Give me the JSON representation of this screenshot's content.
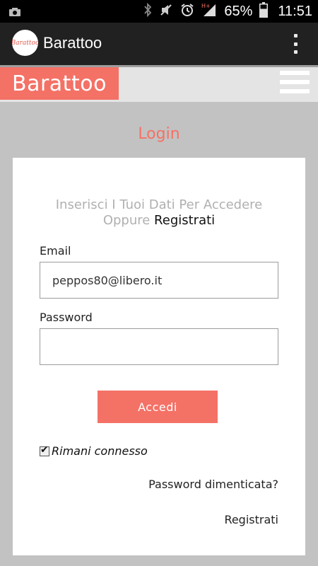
{
  "status_bar": {
    "battery": "65%",
    "time": "11:51",
    "icons": [
      "camera-icon",
      "bluetooth-icon",
      "mute-icon",
      "alarm-icon",
      "signal-icon",
      "battery-icon"
    ]
  },
  "app_bar": {
    "logo_text": "Barattoo",
    "title": "Barattoo",
    "menu_icon": "overflow-menu-icon"
  },
  "header": {
    "brand": "Barattoo",
    "menu_icon": "hamburger-icon"
  },
  "login": {
    "heading": "Login",
    "intro_line1": "Inserisci I Tuoi Dati Per Accedere",
    "intro_line2_prefix": "Oppure ",
    "intro_line2_link": "Registrati",
    "email_label": "Email",
    "email_value": "peppos80@libero.it",
    "password_label": "Password",
    "password_value": "",
    "submit_label": "Accedi",
    "remember_label": "Rimani connesso",
    "remember_checked": true,
    "forgot_label": "Password dimenticata?",
    "register_label": "Registrati"
  },
  "colors": {
    "accent": "#f47166",
    "app_bar": "#212121",
    "page_bg": "#c2c2c2"
  }
}
